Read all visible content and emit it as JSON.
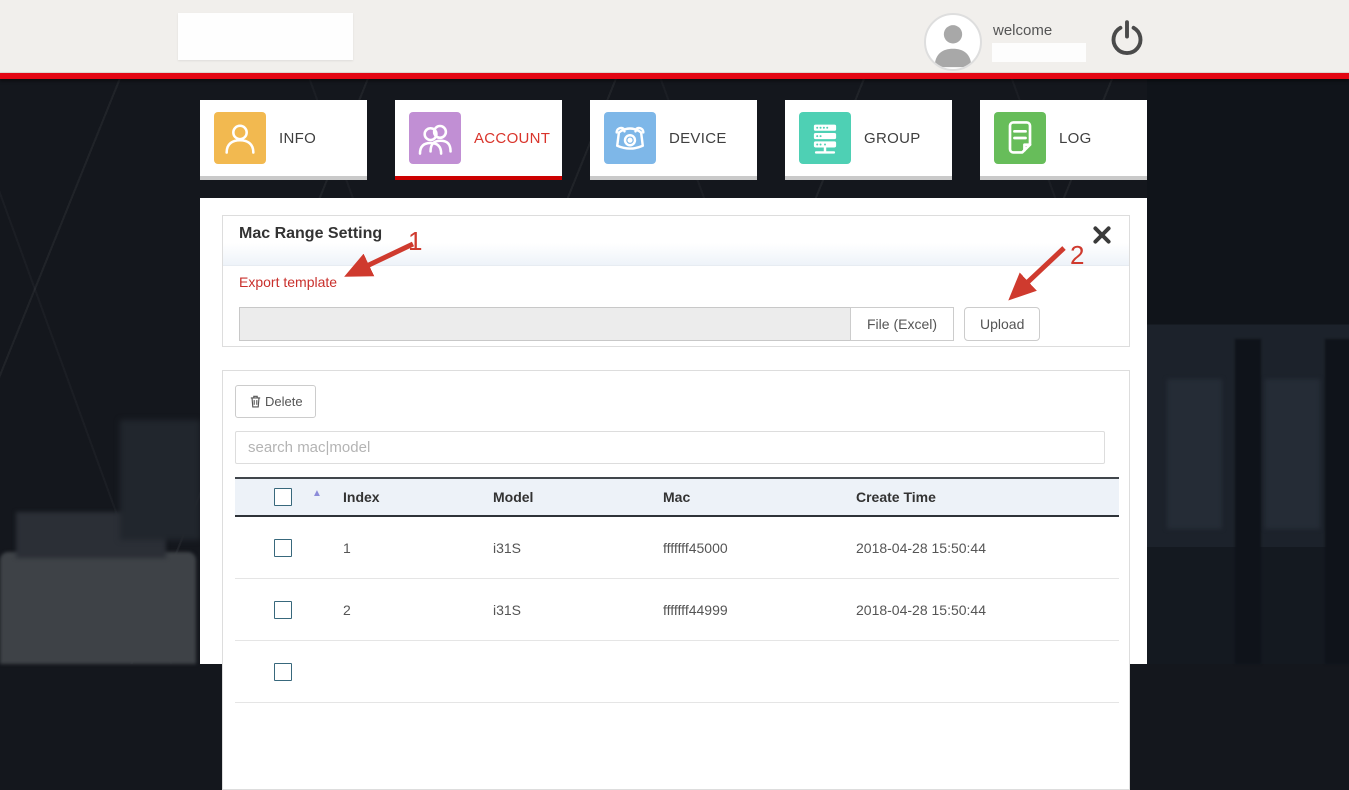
{
  "header": {
    "welcome_label": "welcome"
  },
  "nav": {
    "tabs": [
      {
        "label": "INFO",
        "icon": "person-icon",
        "color": "#f2b950",
        "active": false
      },
      {
        "label": "ACCOUNT",
        "icon": "people-icon",
        "color": "#c18fd4",
        "active": true
      },
      {
        "label": "DEVICE",
        "icon": "phone-icon",
        "color": "#7eb7e8",
        "active": false
      },
      {
        "label": "GROUP",
        "icon": "servers-icon",
        "color": "#4ed0b4",
        "active": false
      },
      {
        "label": "LOG",
        "icon": "document-icon",
        "color": "#67bd5a",
        "active": false
      }
    ]
  },
  "mac_range_panel": {
    "title": "Mac Range Setting",
    "export_link": "Export template",
    "file_button": "File (Excel)",
    "upload_button": "Upload"
  },
  "annotations": {
    "step1": "1",
    "step2": "2"
  },
  "records_panel": {
    "delete_button": "Delete",
    "search_placeholder": "search mac|model",
    "sort_icon": "▲",
    "columns": [
      "Index",
      "Model",
      "Mac",
      "Create Time"
    ],
    "rows": [
      {
        "index": "1",
        "model": "i31S",
        "mac": "fffffff45000",
        "create_time": "2018-04-28 15:50:44"
      },
      {
        "index": "2",
        "model": "i31S",
        "mac": "fffffff44999",
        "create_time": "2018-04-28 15:50:44"
      }
    ]
  },
  "colors": {
    "accent_red": "#e30613",
    "active_tab_text": "#d9342b",
    "link_red": "#c9302c",
    "annotation_red": "#cf3a2e",
    "tab_info": "#f2b950",
    "tab_account": "#c18fd4",
    "tab_device": "#7eb7e8",
    "tab_group": "#4ed0b4",
    "tab_log": "#67bd5a"
  }
}
